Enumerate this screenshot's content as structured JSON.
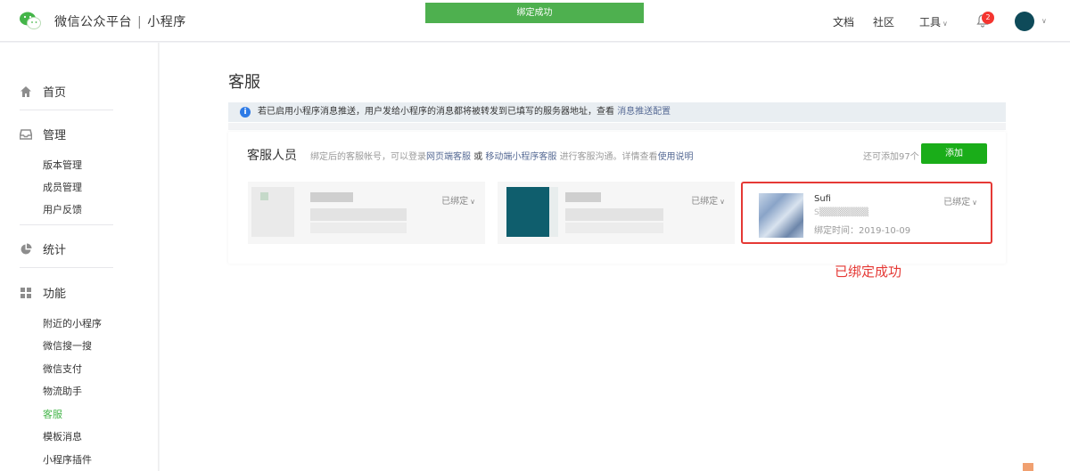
{
  "topbar": {
    "brand_name": "微信公众平台",
    "brand_sep": "|",
    "brand_product": "小程序",
    "toast": "绑定成功",
    "nav_docs": "文档",
    "nav_community": "社区",
    "nav_tools": "工具",
    "notification_count": "2",
    "colors": {
      "toast_bg": "#4eb04f",
      "badge": "#f43530"
    }
  },
  "sidebar": {
    "home": "首页",
    "manage": "管理",
    "manage_items": [
      "版本管理",
      "成员管理",
      "用户反馈"
    ],
    "stats": "统计",
    "features": "功能",
    "feature_items": [
      "附近的小程序",
      "微信搜一搜",
      "微信支付",
      "物流助手",
      "客服",
      "模板消息",
      "小程序插件"
    ],
    "active_item": "客服",
    "active_color": "#44b549"
  },
  "main": {
    "title": "客服",
    "notice": {
      "text": "若已启用小程序消息推送，用户发给小程序的消息都将被转发到已填写的服务器地址，查看",
      "link": "消息推送配置"
    },
    "panel": {
      "title": "客服人员",
      "desc_prefix": "绑定后的客服帐号，可以登录",
      "desc_link1": "网页端客服",
      "desc_or": "或",
      "desc_link2": "移动端小程序客服",
      "desc_mid": "进行客服沟通。详情查看",
      "desc_link3": "使用说明",
      "quota": "还可添加97个",
      "add_button": "添加",
      "cards": [
        {
          "status": "已绑定"
        },
        {
          "status": "已绑定"
        },
        {
          "name": "Sufi",
          "sub": "S▒▒▒▒▒▒▒▒",
          "time": "绑定时间：2019-10-09",
          "status": "已绑定"
        }
      ]
    },
    "success_annotation": "已绑定成功"
  }
}
